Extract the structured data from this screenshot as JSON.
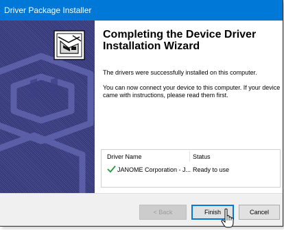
{
  "window": {
    "title": "Driver Package Installer"
  },
  "heading": "Completing the Device Driver Installation Wizard",
  "paragraphs": {
    "success": "The drivers were successfully installed on this computer.",
    "instructions": "You can now connect your device to this computer. If your device came with instructions, please read them first."
  },
  "driver_table": {
    "headers": {
      "name": "Driver Name",
      "status": "Status"
    },
    "rows": [
      {
        "name": "JANOME Corporation - J...",
        "status": "Ready to use",
        "icon": "checkmark-icon"
      }
    ]
  },
  "buttons": {
    "back": "< Back",
    "finish": "Finish",
    "cancel": "Cancel"
  },
  "colors": {
    "titlebar": "#0078d7",
    "banner": "#4a4e96",
    "checkmark": "#1e9b3a"
  }
}
